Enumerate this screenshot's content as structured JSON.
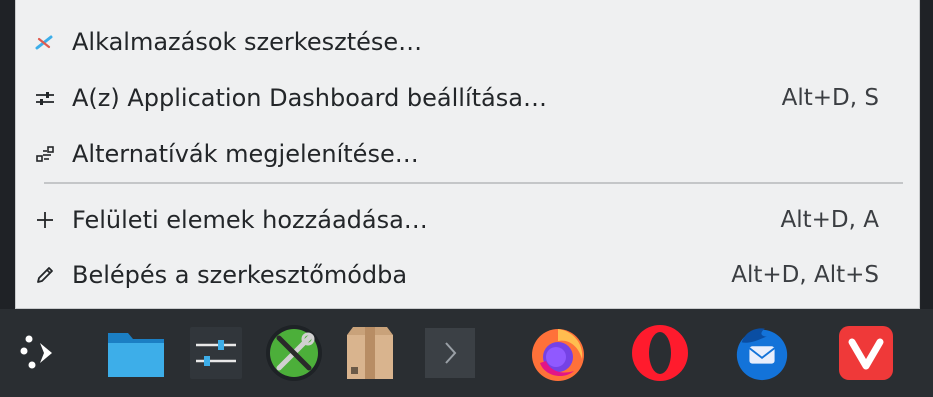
{
  "menu": {
    "items": [
      {
        "label": "Alkalmazások szerkesztése…",
        "shortcut": "",
        "icon": "edit-applications-icon"
      },
      {
        "label": "A(z) Application Dashboard beállítása…",
        "shortcut": "Alt+D, S",
        "icon": "configure-icon"
      },
      {
        "label": "Alternatívák megjelenítése…",
        "shortcut": "",
        "icon": "alternatives-icon"
      },
      {
        "label": "Felületi elemek hozzáadása…",
        "shortcut": "Alt+D, A",
        "icon": "plus-icon"
      },
      {
        "label": "Belépés a szerkesztőmódba",
        "shortcut": "Alt+D, Alt+S",
        "icon": "pencil-icon"
      }
    ]
  },
  "taskbar": {
    "icons": [
      "application-launcher-icon",
      "file-manager-icon",
      "system-settings-icon",
      "kinfocenter-tools-icon",
      "package-manager-icon",
      "terminal-icon",
      "firefox-icon",
      "opera-icon",
      "thunderbird-icon",
      "vivaldi-icon"
    ]
  },
  "colors": {
    "menu_bg": "#eff0f1",
    "taskbar_bg": "#2a2e32",
    "text": "#232629"
  }
}
